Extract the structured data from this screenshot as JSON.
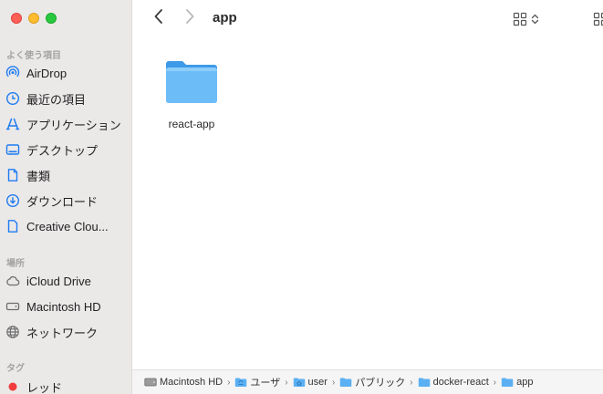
{
  "toolbar": {
    "title": "app",
    "back_icon": "chevron-left-icon",
    "forward_icon": "chevron-right-icon",
    "view_icon": "grid-view-icon",
    "more_icon": "group-icon"
  },
  "sidebar": {
    "favorites_title": "よく使う項目",
    "locations_title": "場所",
    "tags_title": "タグ",
    "favorites": [
      {
        "label": "AirDrop",
        "icon": "airdrop-icon"
      },
      {
        "label": "最近の項目",
        "icon": "clock-icon"
      },
      {
        "label": "アプリケーション",
        "icon": "applications-icon"
      },
      {
        "label": "デスクトップ",
        "icon": "desktop-icon"
      },
      {
        "label": "書類",
        "icon": "document-icon"
      },
      {
        "label": "ダウンロード",
        "icon": "download-icon"
      },
      {
        "label": "Creative Clou...",
        "icon": "file-icon"
      }
    ],
    "locations": [
      {
        "label": "iCloud Drive",
        "icon": "cloud-icon"
      },
      {
        "label": "Macintosh HD",
        "icon": "hard-drive-icon"
      },
      {
        "label": "ネットワーク",
        "icon": "network-icon"
      }
    ],
    "tags": [
      {
        "label": "レッド",
        "icon": "tag-dot-icon",
        "color": "#f03c3c"
      }
    ]
  },
  "content": {
    "items": [
      {
        "name": "react-app",
        "icon": "folder-icon"
      }
    ]
  },
  "pathbar": {
    "crumbs": [
      {
        "label": "Macintosh HD",
        "icon": "hard-drive-icon"
      },
      {
        "label": "ユーザ",
        "icon": "folder-icon"
      },
      {
        "label": "user",
        "icon": "home-folder-icon"
      },
      {
        "label": "パブリック",
        "icon": "folder-icon"
      },
      {
        "label": "docker-react",
        "icon": "folder-icon"
      },
      {
        "label": "app",
        "icon": "folder-icon"
      }
    ],
    "separator": "›"
  },
  "colors": {
    "accent": "#1d7cf2",
    "folder": "#5ab0f2",
    "sidebar_bg": "#ebe8e8"
  }
}
